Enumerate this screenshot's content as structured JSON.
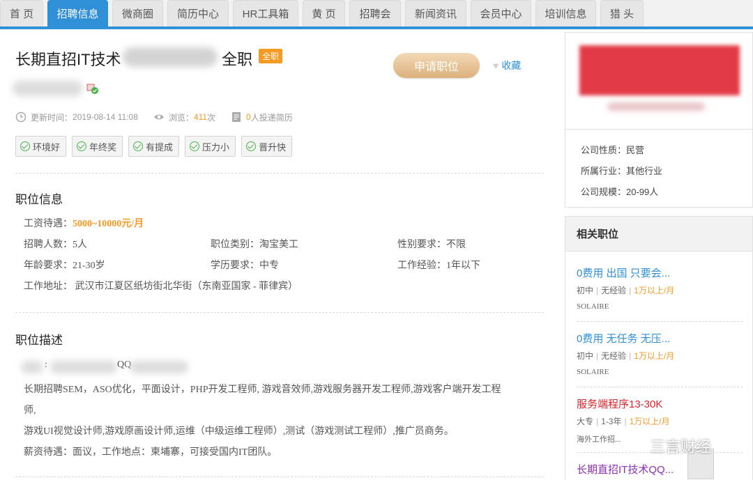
{
  "nav": {
    "tabs": [
      {
        "label": "首 页",
        "active": false
      },
      {
        "label": "招聘信息",
        "active": true
      },
      {
        "label": "微商圈",
        "active": false
      },
      {
        "label": "简历中心",
        "active": false
      },
      {
        "label": "HR工具箱",
        "active": false
      },
      {
        "label": "黄 页",
        "active": false
      },
      {
        "label": "招聘会",
        "active": false
      },
      {
        "label": "新闻资讯",
        "active": false
      },
      {
        "label": "会员中心",
        "active": false
      },
      {
        "label": "培训信息",
        "active": false
      },
      {
        "label": "猎 头",
        "active": false
      }
    ]
  },
  "job": {
    "title_prefix": "长期直招IT技术",
    "title_suffix": "全职",
    "type_badge": "全职",
    "apply_label": "申请职位",
    "favorite_label": "收藏",
    "update_label": "更新时间：",
    "update_time": "2019-08-14 11:08",
    "views_label": "浏览：",
    "views_count": "411",
    "views_unit": "次",
    "applied_count": "0",
    "applied_text": "人投递简历",
    "tags": [
      "环境好",
      "年终奖",
      "有提成",
      "压力小",
      "晋升快"
    ]
  },
  "info": {
    "section_title": "职位信息",
    "salary_label": "工资待遇：",
    "salary_value": "5000~10000元/月",
    "headcount_label": "招聘人数：",
    "headcount_value": "5人",
    "category_label": "职位类别：",
    "category_value": "淘宝美工",
    "gender_label": "性别要求：",
    "gender_value": "不限",
    "age_label": "年龄要求：",
    "age_value": "21-30岁",
    "edu_label": "学历要求：",
    "edu_value": "中专",
    "exp_label": "工作经验：",
    "exp_value": "1年以下",
    "address_label": "工作地址：",
    "address_value": "武汉市江夏区纸坊街北华街（东南亚国家 - 菲律宾）"
  },
  "description": {
    "section_title": "职位描述",
    "contact_colon": ":",
    "contact_qq": "QQ",
    "line1": "长期招聘SEM，ASO优化，平面设计，PHP开发工程师, 游戏音效师,游戏服务器开发工程师,游戏客户端开发工程",
    "line2": "师,",
    "line3": "游戏UI视觉设计师,游戏原画设计师,运维（中级运维工程师）,测试（游戏测试工程师）,推广员商务。",
    "line4": "薪资待遇：面议，工作地点：柬埔寨，可接受国内IT团队。"
  },
  "company": {
    "nature_label": "公司性质：",
    "nature_value": "民营",
    "industry_label": "所属行业：",
    "industry_value": "其他行业",
    "size_label": "公司规模：",
    "size_value": "20-99人"
  },
  "related": {
    "header": "相关职位",
    "jobs": [
      {
        "title": "0费用 出国 只要会...",
        "edu": "初中",
        "exp": "无经验",
        "pay": "1万以上/月",
        "company": "SOLAIRE"
      },
      {
        "title": "0费用 无任务 无压...",
        "edu": "初中",
        "exp": "无经验",
        "pay": "1万以上/月",
        "company": "SOLAIRE"
      },
      {
        "title": "服务端程序13-30K",
        "edu": "大专",
        "exp": "1-3年",
        "pay": "1万以上/月",
        "company": "海外工作招..."
      },
      {
        "title": "长期直招IT技术QQ..."
      }
    ]
  },
  "watermark": {
    "text": "三言财经"
  },
  "colors": {
    "accent": "#2f8fd7",
    "orange": "#f59a23",
    "green": "#4bb34b",
    "red": "#d9252c"
  }
}
